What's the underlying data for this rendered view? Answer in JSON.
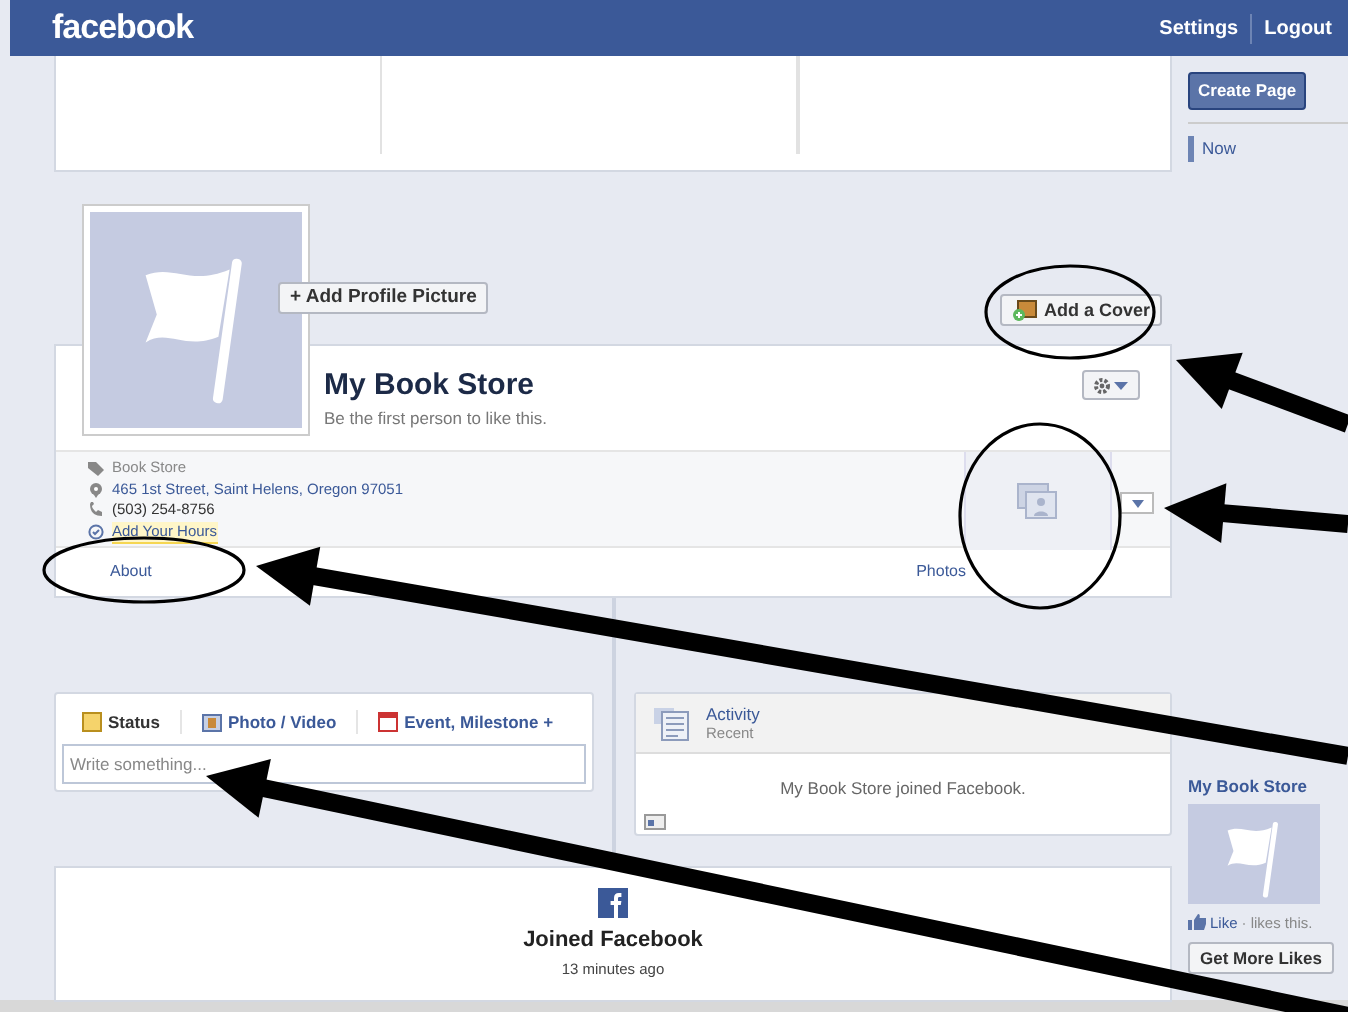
{
  "header": {
    "logo": "facebook",
    "links": [
      "Settings",
      "Logout"
    ]
  },
  "sidebar": {
    "create_button": "Create Page",
    "timeline_items": [
      {
        "label": "Now",
        "selected": true
      }
    ],
    "promo": {
      "page_name": "My Book Store",
      "like_link": "Like",
      "like_text": "· likes this.",
      "button": "Get More Likes"
    }
  },
  "profile": {
    "add_picture_button": "+ Add Profile Picture",
    "add_cover_button": "Add a Cover",
    "name": "My Book Store",
    "subtitle": "Be the first person to like this.",
    "details": [
      {
        "kind": "category",
        "text": "Book Store"
      },
      {
        "kind": "address",
        "text": "465 1st Street, Saint Helens, Oregon 97051"
      },
      {
        "kind": "phone",
        "text": "(503) 254-8756"
      },
      {
        "kind": "hours",
        "text": "Add Your Hours"
      }
    ],
    "about_link": "About",
    "photos_link": "Photos"
  },
  "composer": {
    "tabs": [
      {
        "label": "Status",
        "selected": true
      },
      {
        "label": "Photo / Video",
        "selected": false
      },
      {
        "label": "Event, Milestone +",
        "selected": false
      }
    ],
    "placeholder": "Write something..."
  },
  "activity": {
    "title": "Activity",
    "subtitle": "Recent",
    "message": "My Book Store joined Facebook."
  },
  "story": {
    "title": "Joined Facebook",
    "time": "13 minutes ago"
  }
}
